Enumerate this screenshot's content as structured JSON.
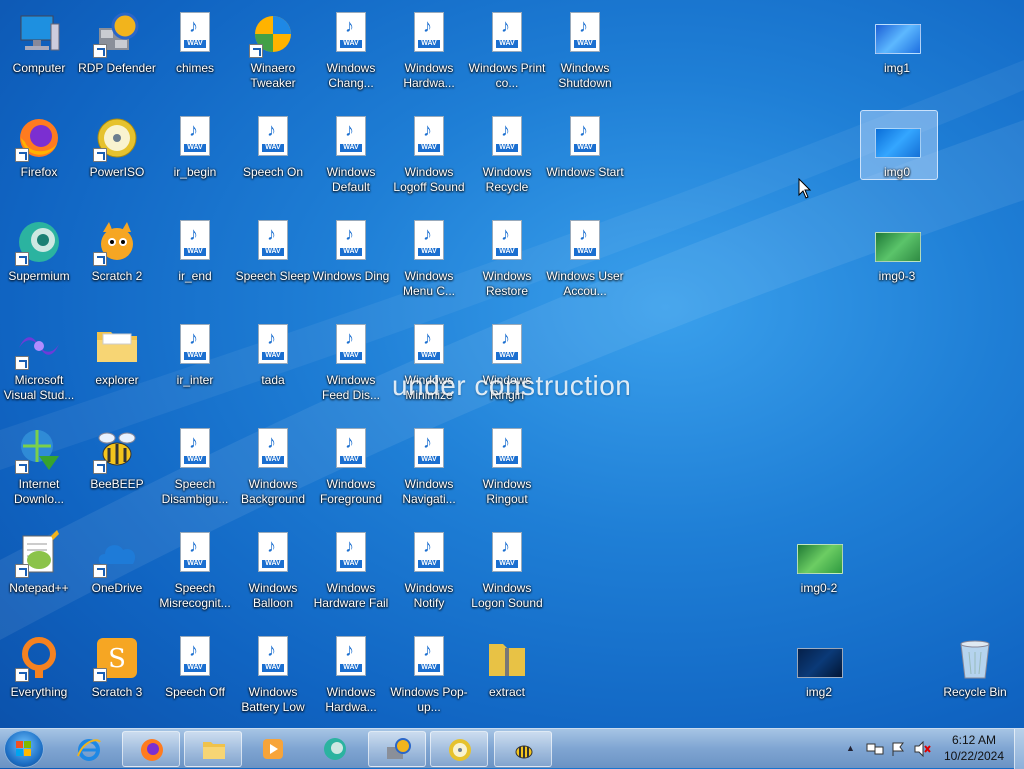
{
  "desktop": {
    "watermark": "under construction",
    "icons": [
      {
        "label": "Computer",
        "kind": "computer",
        "col": 0,
        "row": 0
      },
      {
        "label": "RDP Defender",
        "kind": "rdp",
        "col": 1,
        "row": 0,
        "shortcut": true
      },
      {
        "label": "chimes",
        "kind": "wav",
        "col": 2,
        "row": 0
      },
      {
        "label": "Winaero Tweaker",
        "kind": "winaero",
        "col": 3,
        "row": 0,
        "shortcut": true
      },
      {
        "label": "Windows Chang...",
        "kind": "wav",
        "col": 4,
        "row": 0
      },
      {
        "label": "Windows Hardwa...",
        "kind": "wav",
        "col": 5,
        "row": 0
      },
      {
        "label": "Windows Print co...",
        "kind": "wav",
        "col": 6,
        "row": 0
      },
      {
        "label": "Windows Shutdown",
        "kind": "wav",
        "col": 7,
        "row": 0
      },
      {
        "label": "Firefox",
        "kind": "firefox",
        "col": 0,
        "row": 1,
        "shortcut": true
      },
      {
        "label": "PowerISO",
        "kind": "poweriso",
        "col": 1,
        "row": 1,
        "shortcut": true
      },
      {
        "label": "ir_begin",
        "kind": "wav",
        "col": 2,
        "row": 1
      },
      {
        "label": "Speech On",
        "kind": "wav",
        "col": 3,
        "row": 1
      },
      {
        "label": "Windows Default",
        "kind": "wav",
        "col": 4,
        "row": 1
      },
      {
        "label": "Windows Logoff Sound",
        "kind": "wav",
        "col": 5,
        "row": 1
      },
      {
        "label": "Windows Recycle",
        "kind": "wav",
        "col": 6,
        "row": 1
      },
      {
        "label": "Windows Start",
        "kind": "wav",
        "col": 7,
        "row": 1
      },
      {
        "label": "Supermium",
        "kind": "supermium",
        "col": 0,
        "row": 2,
        "shortcut": true
      },
      {
        "label": "Scratch 2",
        "kind": "scratch",
        "col": 1,
        "row": 2,
        "shortcut": true
      },
      {
        "label": "ir_end",
        "kind": "wav",
        "col": 2,
        "row": 2
      },
      {
        "label": "Speech Sleep",
        "kind": "wav",
        "col": 3,
        "row": 2
      },
      {
        "label": "Windows Ding",
        "kind": "wav",
        "col": 4,
        "row": 2
      },
      {
        "label": "Windows Menu C...",
        "kind": "wav",
        "col": 5,
        "row": 2
      },
      {
        "label": "Windows Restore",
        "kind": "wav",
        "col": 6,
        "row": 2
      },
      {
        "label": "Windows User Accou...",
        "kind": "wav",
        "col": 7,
        "row": 2
      },
      {
        "label": "Microsoft Visual Stud...",
        "kind": "vs",
        "col": 0,
        "row": 3,
        "shortcut": true
      },
      {
        "label": "explorer",
        "kind": "folder",
        "col": 1,
        "row": 3
      },
      {
        "label": "ir_inter",
        "kind": "wav",
        "col": 2,
        "row": 3
      },
      {
        "label": "tada",
        "kind": "wav",
        "col": 3,
        "row": 3
      },
      {
        "label": "Windows Feed Dis...",
        "kind": "wav",
        "col": 4,
        "row": 3
      },
      {
        "label": "Windows Minimize",
        "kind": "wav",
        "col": 5,
        "row": 3
      },
      {
        "label": "Windows Ringin",
        "kind": "wav",
        "col": 6,
        "row": 3
      },
      {
        "label": "Internet Downlo...",
        "kind": "idm",
        "col": 0,
        "row": 4,
        "shortcut": true
      },
      {
        "label": "BeeBEEP",
        "kind": "bee",
        "col": 1,
        "row": 4,
        "shortcut": true
      },
      {
        "label": "Speech Disambigu...",
        "kind": "wav",
        "col": 2,
        "row": 4
      },
      {
        "label": "Windows Background",
        "kind": "wav",
        "col": 3,
        "row": 4
      },
      {
        "label": "Windows Foreground",
        "kind": "wav",
        "col": 4,
        "row": 4
      },
      {
        "label": "Windows Navigati...",
        "kind": "wav",
        "col": 5,
        "row": 4
      },
      {
        "label": "Windows Ringout",
        "kind": "wav",
        "col": 6,
        "row": 4
      },
      {
        "label": "Notepad++",
        "kind": "npp",
        "col": 0,
        "row": 5,
        "shortcut": true
      },
      {
        "label": "OneDrive",
        "kind": "onedrive",
        "col": 1,
        "row": 5,
        "shortcut": true
      },
      {
        "label": "Speech Misrecognit...",
        "kind": "wav",
        "col": 2,
        "row": 5
      },
      {
        "label": "Windows Balloon",
        "kind": "wav",
        "col": 3,
        "row": 5
      },
      {
        "label": "Windows Hardware Fail",
        "kind": "wav",
        "col": 4,
        "row": 5
      },
      {
        "label": "Windows Notify",
        "kind": "wav",
        "col": 5,
        "row": 5
      },
      {
        "label": "Windows Logon Sound",
        "kind": "wav",
        "col": 6,
        "row": 5
      },
      {
        "label": "Everything",
        "kind": "everything",
        "col": 0,
        "row": 6,
        "shortcut": true
      },
      {
        "label": "Scratch 3",
        "kind": "scratch3",
        "col": 1,
        "row": 6,
        "shortcut": true
      },
      {
        "label": "Speech Off",
        "kind": "wav",
        "col": 2,
        "row": 6
      },
      {
        "label": "Windows Battery Low",
        "kind": "wav",
        "col": 3,
        "row": 6
      },
      {
        "label": "Windows Hardwa...",
        "kind": "wav",
        "col": 4,
        "row": 6
      },
      {
        "label": "Windows Pop-up...",
        "kind": "wav",
        "col": 5,
        "row": 6
      },
      {
        "label": "extract",
        "kind": "zip",
        "col": 6,
        "row": 6
      },
      {
        "label": "img1",
        "kind": "img1",
        "col": 11,
        "row": 0
      },
      {
        "label": "img0",
        "kind": "img0",
        "col": 11,
        "row": 1,
        "selected": true
      },
      {
        "label": "img0-3",
        "kind": "img03",
        "col": 11,
        "row": 2
      },
      {
        "label": "img0-2",
        "kind": "img02",
        "col": 10,
        "row": 5
      },
      {
        "label": "img2",
        "kind": "img2",
        "col": 10,
        "row": 6
      },
      {
        "label": "Recycle Bin",
        "kind": "recycle",
        "col": 12,
        "row": 6
      }
    ]
  },
  "taskbar": {
    "pinned": [
      {
        "name": "internet-explorer",
        "open": false
      },
      {
        "name": "firefox",
        "open": true
      },
      {
        "name": "explorer",
        "open": true
      },
      {
        "name": "media-player",
        "open": false
      },
      {
        "name": "supermium",
        "open": false
      },
      {
        "name": "rdp-defender",
        "open": true
      },
      {
        "name": "poweriso",
        "open": true
      },
      {
        "name": "beebeep",
        "open": true
      }
    ],
    "time": "6:12 AM",
    "date": "10/22/2024",
    "tray_up_arrow": "▲"
  },
  "colors": {
    "accent": "#1b6fd0",
    "taskbar": "#7fa5d2"
  }
}
